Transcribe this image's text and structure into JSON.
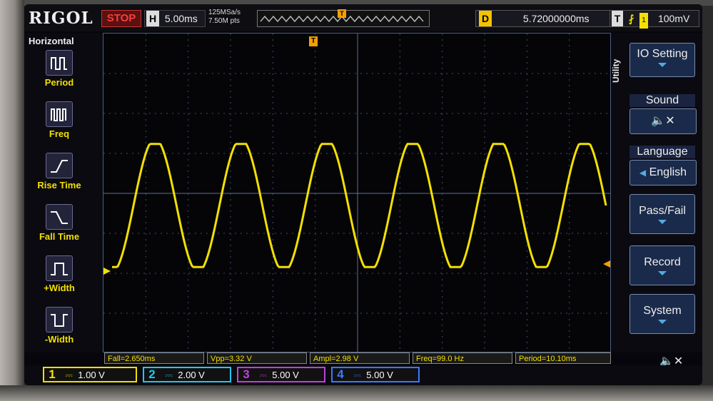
{
  "top": {
    "brand": "RIGOL",
    "run_state": "STOP",
    "horizontal_label": "H",
    "timebase": "5.00ms",
    "sample_rate": "125MSa/s",
    "memory_depth": "7.50M pts",
    "trigger_marker": "T",
    "delay_label": "D",
    "delay": "5.72000000ms",
    "trigger_label": "T",
    "trigger_channel": "1",
    "trigger_level": "100mV"
  },
  "left_menu": {
    "title": "Horizontal",
    "items": [
      {
        "label": "Period",
        "icon": "period-icon"
      },
      {
        "label": "Freq",
        "icon": "frequency-icon"
      },
      {
        "label": "Rise Time",
        "icon": "rise-time-icon"
      },
      {
        "label": "Fall Time",
        "icon": "fall-time-icon"
      },
      {
        "label": "+Width",
        "icon": "positive-width-icon"
      },
      {
        "label": "-Width",
        "icon": "negative-width-icon"
      }
    ]
  },
  "right_menu": {
    "title": "Utility",
    "io_setting": "IO Setting",
    "sound_label": "Sound",
    "language_label": "Language",
    "language_value": "English",
    "pass_fail": "Pass/Fail",
    "record": "Record",
    "system": "System"
  },
  "measurements": [
    {
      "label": "Fall=2.650ms"
    },
    {
      "label": "Vpp=3.32 V"
    },
    {
      "label": "Ampl=2.98 V"
    },
    {
      "label": "Freq=99.0 Hz"
    },
    {
      "label": "Period=10.10ms"
    }
  ],
  "channels": [
    {
      "number": "1",
      "scale": "1.00 V",
      "color": "#f3e000"
    },
    {
      "number": "2",
      "scale": "2.00 V",
      "color": "#22c8f0"
    },
    {
      "number": "3",
      "scale": "5.00 V",
      "color": "#c040e0"
    },
    {
      "number": "4",
      "scale": "5.00 V",
      "color": "#3a7aff"
    }
  ],
  "waveform": {
    "channel": "1",
    "shape": "sine",
    "cycles_visible": 6,
    "color": "#f3e000"
  }
}
